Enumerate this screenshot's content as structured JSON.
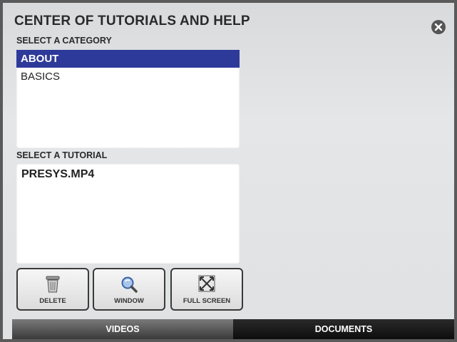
{
  "header": {
    "title": "CENTER OF TUTORIALS AND HELP"
  },
  "category": {
    "label": "SELECT A CATEGORY",
    "items": [
      {
        "label": "ABOUT",
        "selected": true
      },
      {
        "label": "BASICS",
        "selected": false
      }
    ]
  },
  "tutorial": {
    "label": "SELECT A TUTORIAL",
    "items": [
      {
        "label": "PRESYS.MP4"
      }
    ]
  },
  "toolbar": {
    "delete_label": "DELETE",
    "window_label": "WINDOW",
    "fullscreen_label": "FULL SCREEN"
  },
  "tabs": [
    {
      "label": "VIDEOS",
      "active": true
    },
    {
      "label": "DOCUMENTS",
      "active": false
    }
  ],
  "colors": {
    "selection": "#2d3a9a",
    "frame": "#5a5a5a"
  }
}
